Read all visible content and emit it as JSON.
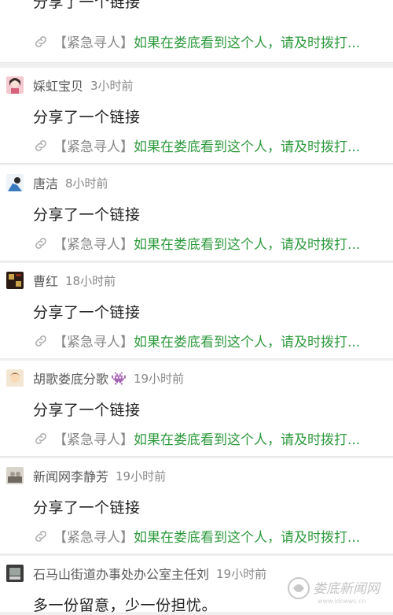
{
  "feed": {
    "posts": [
      {
        "user": "",
        "time": "",
        "text": "分享了一个链接",
        "link_tag": "【紧急寻人】",
        "link_title": "如果在娄底看到这个人，请及时拨打..."
      },
      {
        "user": "婇虹宝贝",
        "time": "3小时前",
        "text": "分享了一个链接",
        "link_tag": "【紧急寻人】",
        "link_title": "如果在娄底看到这个人，请及时拨打..."
      },
      {
        "user": "唐洁",
        "time": "8小时前",
        "text": "分享了一个链接",
        "link_tag": "【紧急寻人】",
        "link_title": "如果在娄底看到这个人，请及时拨打..."
      },
      {
        "user": "曹红",
        "time": "18小时前",
        "text": "分享了一个链接",
        "link_tag": "【紧急寻人】",
        "link_title": "如果在娄底看到这个人，请及时拨打..."
      },
      {
        "user": "胡歌娄底分歌",
        "user_emoji": "👾",
        "time": "19小时前",
        "text": "分享了一个链接",
        "link_tag": "【紧急寻人】",
        "link_title": "如果在娄底看到这个人，请及时拨打..."
      },
      {
        "user": "新闻网李静芳",
        "time": "19小时前",
        "text": "分享了一个链接",
        "link_tag": "【紧急寻人】",
        "link_title": "如果在娄底看到这个人，请及时拨打..."
      },
      {
        "user": "石马山街道办事处办公室主任刘",
        "time": "19小时前",
        "text": "多一份留意，少一份担忧。"
      }
    ]
  },
  "watermark": {
    "text": "娄底新闻网",
    "subtext": "www.ldnews.cn"
  },
  "colors": {
    "link_green": "#2d9a3d",
    "tag_gray": "#888888",
    "background": "#f0f0f0"
  },
  "icons": {
    "link": "link-icon"
  }
}
